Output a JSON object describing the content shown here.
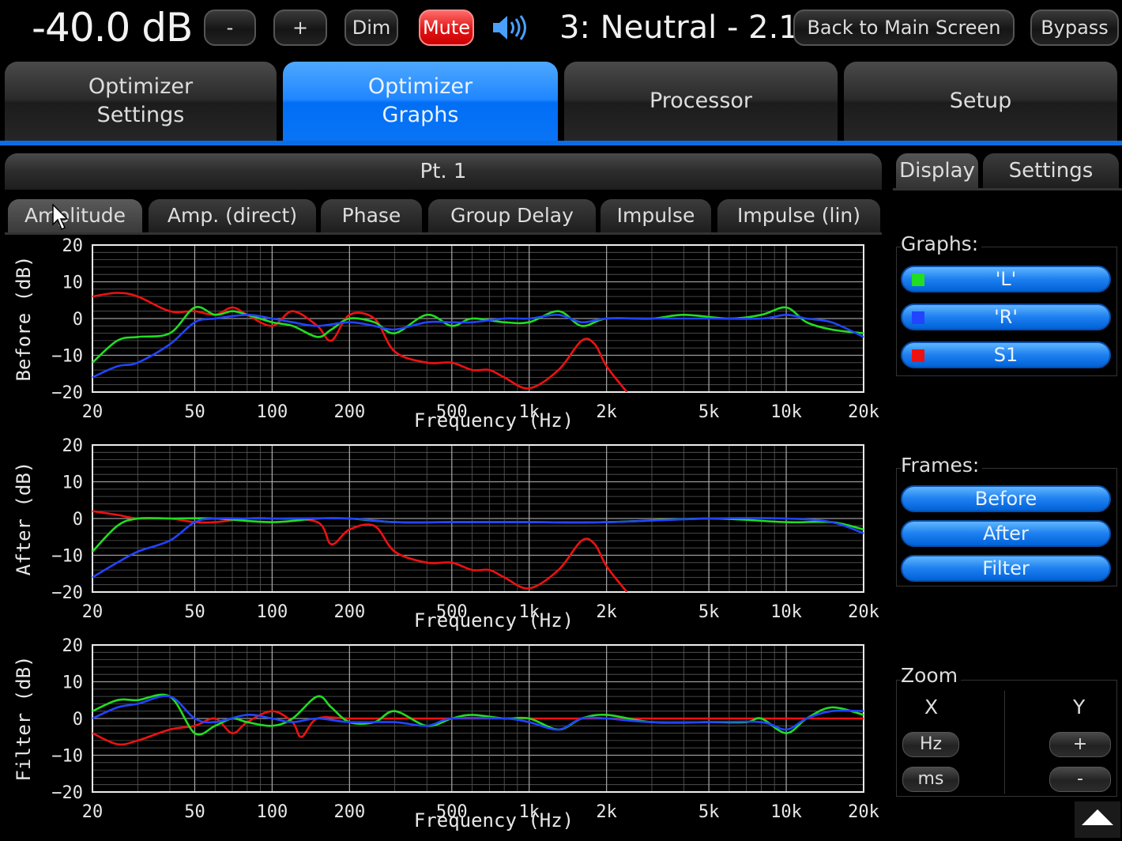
{
  "header": {
    "volume": "-40.0 dB",
    "minus": "-",
    "plus": "+",
    "dim": "Dim",
    "mute": "Mute",
    "preset": "3: Neutral - 2.1",
    "back": "Back to Main Screen",
    "bypass": "Bypass"
  },
  "main_tabs": [
    {
      "line1": "Optimizer",
      "line2": "Settings"
    },
    {
      "line1": "Optimizer",
      "line2": "Graphs"
    },
    {
      "line1": "Processor",
      "line2": ""
    },
    {
      "line1": "Setup",
      "line2": ""
    }
  ],
  "point_title": "Pt. 1",
  "graph_tabs": [
    "Amplitude",
    "Amp. (direct)",
    "Phase",
    "Group Delay",
    "Impulse",
    "Impulse (lin)"
  ],
  "right_tabs": [
    "Display",
    "Settings"
  ],
  "graphs_group": {
    "label": "Graphs:",
    "items": [
      {
        "name": "'L'",
        "color": "#22dd22"
      },
      {
        "name": "'R'",
        "color": "#2244ff"
      },
      {
        "name": "S1",
        "color": "#ee1111"
      }
    ]
  },
  "frames_group": {
    "label": "Frames:",
    "items": [
      "Before",
      "After",
      "Filter"
    ]
  },
  "zoom_group": {
    "label": "Zoom",
    "x_label": "X",
    "y_label": "Y",
    "hz": "Hz",
    "ms": "ms",
    "plus": "+",
    "minus": "-"
  },
  "chart_data": [
    {
      "type": "line",
      "ylabel": "Before (dB)",
      "xlabel": "Frequency (Hz)",
      "x_scale": "log",
      "xlim": [
        20,
        20000
      ],
      "ylim": [
        -20,
        20
      ],
      "xticks": [
        20,
        50,
        100,
        200,
        500,
        1000,
        2000,
        5000,
        10000,
        20000
      ],
      "xtick_labels": [
        "20",
        "50",
        "100",
        "200",
        "500",
        "1k",
        "2k",
        "5k",
        "10k",
        "20k"
      ],
      "yticks": [
        20,
        10,
        0,
        -10,
        -20
      ],
      "ytick_labels": [
        "20",
        "10",
        "0",
        "−10",
        "−20"
      ],
      "series": [
        {
          "color": "#ee1111",
          "points": [
            [
              20,
              6
            ],
            [
              25,
              7
            ],
            [
              30,
              6
            ],
            [
              40,
              2
            ],
            [
              50,
              2
            ],
            [
              60,
              1
            ],
            [
              70,
              3
            ],
            [
              80,
              1
            ],
            [
              100,
              -2
            ],
            [
              120,
              2
            ],
            [
              150,
              -2
            ],
            [
              170,
              -6
            ],
            [
              200,
              1
            ],
            [
              250,
              0
            ],
            [
              300,
              -9
            ],
            [
              400,
              -12
            ],
            [
              500,
              -12
            ],
            [
              600,
              -14
            ],
            [
              700,
              -14
            ],
            [
              800,
              -16
            ],
            [
              1000,
              -19
            ],
            [
              1300,
              -14
            ],
            [
              1600,
              -6
            ],
            [
              1800,
              -7
            ],
            [
              2000,
              -13
            ],
            [
              2400,
              -20
            ]
          ]
        },
        {
          "color": "#22dd22",
          "points": [
            [
              20,
              -12
            ],
            [
              25,
              -6
            ],
            [
              30,
              -5
            ],
            [
              40,
              -4
            ],
            [
              50,
              3
            ],
            [
              60,
              1
            ],
            [
              70,
              2
            ],
            [
              80,
              1
            ],
            [
              100,
              -1
            ],
            [
              120,
              -2
            ],
            [
              150,
              -5
            ],
            [
              170,
              -3
            ],
            [
              200,
              0
            ],
            [
              250,
              -1
            ],
            [
              300,
              -4
            ],
            [
              400,
              1
            ],
            [
              500,
              -2
            ],
            [
              600,
              0
            ],
            [
              800,
              -1
            ],
            [
              1000,
              -1
            ],
            [
              1300,
              2
            ],
            [
              1600,
              -2
            ],
            [
              2000,
              0
            ],
            [
              3000,
              0
            ],
            [
              4000,
              1
            ],
            [
              6000,
              0
            ],
            [
              8000,
              1
            ],
            [
              10000,
              3
            ],
            [
              12000,
              -1
            ],
            [
              15000,
              -3
            ],
            [
              20000,
              -4
            ]
          ]
        },
        {
          "color": "#2244ff",
          "points": [
            [
              20,
              -16
            ],
            [
              25,
              -13
            ],
            [
              30,
              -12
            ],
            [
              40,
              -7
            ],
            [
              50,
              -1
            ],
            [
              60,
              0
            ],
            [
              80,
              1
            ],
            [
              100,
              0
            ],
            [
              120,
              -1
            ],
            [
              150,
              -2
            ],
            [
              200,
              -1
            ],
            [
              250,
              -2
            ],
            [
              300,
              -3
            ],
            [
              400,
              -1
            ],
            [
              500,
              -1
            ],
            [
              600,
              -1
            ],
            [
              800,
              0
            ],
            [
              1000,
              0
            ],
            [
              1300,
              1
            ],
            [
              1600,
              -1
            ],
            [
              2000,
              0
            ],
            [
              3000,
              0
            ],
            [
              5000,
              0
            ],
            [
              8000,
              0
            ],
            [
              10000,
              1
            ],
            [
              12000,
              0
            ],
            [
              15000,
              -1
            ],
            [
              20000,
              -5
            ]
          ]
        }
      ]
    },
    {
      "type": "line",
      "ylabel": "After (dB)",
      "xlabel": "Frequency (Hz)",
      "x_scale": "log",
      "xlim": [
        20,
        20000
      ],
      "ylim": [
        -20,
        20
      ],
      "xticks": [
        20,
        50,
        100,
        200,
        500,
        1000,
        2000,
        5000,
        10000,
        20000
      ],
      "xtick_labels": [
        "20",
        "50",
        "100",
        "200",
        "500",
        "1k",
        "2k",
        "5k",
        "10k",
        "20k"
      ],
      "yticks": [
        20,
        10,
        0,
        -10,
        -20
      ],
      "ytick_labels": [
        "20",
        "10",
        "0",
        "−10",
        "−20"
      ],
      "series": [
        {
          "color": "#ee1111",
          "points": [
            [
              20,
              2
            ],
            [
              25,
              1
            ],
            [
              30,
              0
            ],
            [
              40,
              0
            ],
            [
              50,
              -1
            ],
            [
              60,
              -1
            ],
            [
              80,
              0
            ],
            [
              100,
              0
            ],
            [
              150,
              -1
            ],
            [
              170,
              -7
            ],
            [
              200,
              -3
            ],
            [
              250,
              -2
            ],
            [
              300,
              -9
            ],
            [
              400,
              -12
            ],
            [
              500,
              -12
            ],
            [
              600,
              -14
            ],
            [
              700,
              -14
            ],
            [
              800,
              -16
            ],
            [
              1000,
              -19
            ],
            [
              1300,
              -14
            ],
            [
              1600,
              -6
            ],
            [
              1800,
              -7
            ],
            [
              2000,
              -13
            ],
            [
              2400,
              -20
            ]
          ]
        },
        {
          "color": "#22dd22",
          "points": [
            [
              20,
              -9
            ],
            [
              25,
              -2
            ],
            [
              30,
              0
            ],
            [
              40,
              0
            ],
            [
              60,
              0
            ],
            [
              100,
              -1
            ],
            [
              150,
              0
            ],
            [
              200,
              0
            ],
            [
              300,
              -1
            ],
            [
              500,
              -1
            ],
            [
              1000,
              -1
            ],
            [
              2000,
              -1
            ],
            [
              5000,
              0
            ],
            [
              10000,
              -1
            ],
            [
              15000,
              -1
            ],
            [
              20000,
              -3
            ]
          ]
        },
        {
          "color": "#2244ff",
          "points": [
            [
              20,
              -16
            ],
            [
              25,
              -12
            ],
            [
              30,
              -9
            ],
            [
              40,
              -6
            ],
            [
              50,
              -1
            ],
            [
              60,
              0
            ],
            [
              80,
              0
            ],
            [
              100,
              0
            ],
            [
              200,
              0
            ],
            [
              300,
              -1
            ],
            [
              500,
              -1
            ],
            [
              1000,
              -1
            ],
            [
              2000,
              -1
            ],
            [
              5000,
              0
            ],
            [
              10000,
              0
            ],
            [
              15000,
              -1
            ],
            [
              20000,
              -4
            ]
          ]
        }
      ]
    },
    {
      "type": "line",
      "ylabel": "Filter (dB)",
      "xlabel": "Frequency (Hz)",
      "x_scale": "log",
      "xlim": [
        20,
        20000
      ],
      "ylim": [
        -20,
        20
      ],
      "xticks": [
        20,
        50,
        100,
        200,
        500,
        1000,
        2000,
        5000,
        10000,
        20000
      ],
      "xtick_labels": [
        "20",
        "50",
        "100",
        "200",
        "500",
        "1k",
        "2k",
        "5k",
        "10k",
        "20k"
      ],
      "yticks": [
        20,
        10,
        0,
        -10,
        -20
      ],
      "ytick_labels": [
        "20",
        "10",
        "0",
        "−10",
        "−20"
      ],
      "series": [
        {
          "color": "#ee1111",
          "points": [
            [
              20,
              -4
            ],
            [
              25,
              -7
            ],
            [
              30,
              -6
            ],
            [
              40,
              -3
            ],
            [
              50,
              -2
            ],
            [
              60,
              0
            ],
            [
              70,
              -4
            ],
            [
              80,
              -1
            ],
            [
              100,
              2
            ],
            [
              120,
              -1
            ],
            [
              130,
              -5
            ],
            [
              150,
              0
            ],
            [
              200,
              0
            ],
            [
              300,
              0
            ],
            [
              500,
              0
            ],
            [
              1000,
              0
            ],
            [
              2000,
              0
            ],
            [
              5000,
              0
            ],
            [
              10000,
              0
            ],
            [
              20000,
              0
            ]
          ]
        },
        {
          "color": "#22dd22",
          "points": [
            [
              20,
              2
            ],
            [
              25,
              5
            ],
            [
              30,
              5
            ],
            [
              40,
              6
            ],
            [
              50,
              -4
            ],
            [
              60,
              -2
            ],
            [
              70,
              0
            ],
            [
              80,
              -1
            ],
            [
              100,
              -2
            ],
            [
              120,
              0
            ],
            [
              150,
              6
            ],
            [
              170,
              3
            ],
            [
              200,
              -1
            ],
            [
              250,
              -1
            ],
            [
              300,
              2
            ],
            [
              400,
              -2
            ],
            [
              500,
              0
            ],
            [
              600,
              1
            ],
            [
              800,
              0
            ],
            [
              1000,
              0
            ],
            [
              1300,
              -3
            ],
            [
              1600,
              0
            ],
            [
              2000,
              1
            ],
            [
              3000,
              -1
            ],
            [
              5000,
              -1
            ],
            [
              7000,
              -1
            ],
            [
              8000,
              0
            ],
            [
              10000,
              -4
            ],
            [
              12000,
              0
            ],
            [
              15000,
              3
            ],
            [
              20000,
              1
            ]
          ]
        },
        {
          "color": "#2244ff",
          "points": [
            [
              20,
              0
            ],
            [
              25,
              3
            ],
            [
              30,
              4
            ],
            [
              40,
              6
            ],
            [
              50,
              0
            ],
            [
              60,
              -1
            ],
            [
              80,
              1
            ],
            [
              100,
              0
            ],
            [
              120,
              -1
            ],
            [
              150,
              0
            ],
            [
              200,
              -1
            ],
            [
              300,
              -1
            ],
            [
              400,
              -2
            ],
            [
              500,
              0
            ],
            [
              800,
              0
            ],
            [
              1000,
              -1
            ],
            [
              1300,
              -3
            ],
            [
              1600,
              0
            ],
            [
              2000,
              0
            ],
            [
              3000,
              -1
            ],
            [
              5000,
              -1
            ],
            [
              8000,
              -1
            ],
            [
              10000,
              -3
            ],
            [
              12000,
              0
            ],
            [
              15000,
              2
            ],
            [
              20000,
              2
            ]
          ]
        }
      ]
    }
  ]
}
